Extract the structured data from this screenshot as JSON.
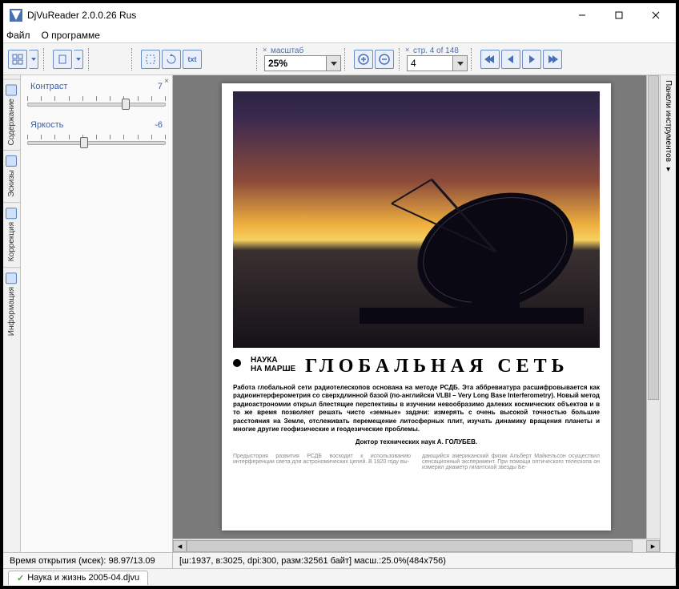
{
  "window": {
    "title": "DjVuReader 2.0.0.26 Rus"
  },
  "menu": {
    "file": "Файл",
    "about": "О программе"
  },
  "toolbar": {
    "scale_label": "масштаб",
    "scale_value": "25%",
    "page_label": "стр. 4 of 148",
    "page_value": "4"
  },
  "side_tabs": {
    "contents": "Содержание",
    "thumbnails": "Эскизы",
    "correction": "Коррекция",
    "information": "Информация"
  },
  "correction": {
    "contrast_label": "Контраст",
    "contrast_value": "7",
    "brightness_label": "Яркость",
    "brightness_value": "-6"
  },
  "right_panel": {
    "label": "Панели инструментов"
  },
  "document": {
    "subhead_line1": "НАУКА",
    "subhead_line2": "НА МАРШЕ",
    "headline": "ГЛОБАЛЬНАЯ СЕТЬ",
    "intro": "Работа глобальной сети радиотелескопов основана на методе РСДБ. Эта аббревиатура расшифровывается как радиоинтерферометрия со сверхдлинной базой (по-английски VLBI – Very Long Base Interferometry). Новый метод радиоастрономии открыл блестящие перспективы в изучении невообразимо далеких космических объектов и в то же время позволяет решать чисто «земные» задачи: измерять с очень высокой точностью большие расстояния на Земле, отслеживать перемещение литосферных плит, изучать динамику вращения планеты и многие другие геофизические и геодезические проблемы.",
    "author": "Доктор технических наук А. ГОЛУБЕВ.",
    "col1": "Предыстория развития РСДБ восходит к использованию интерференции света для астрономических целей. В 1920 году вы-",
    "col2": "дающийся американский физик Альберт Майкельсон осуществил сенсационный эксперимент. При помощи оптического телескопа он измерил диаметр гигантской звезды Бе-"
  },
  "status": {
    "open_time": "Время открытия (мсек): 98.97/13.09",
    "info": "[ш:1937, в:3025, dpi:300, разм:32561 байт] масш.:25.0%(484x756)"
  },
  "tab": {
    "filename": "Наука и жизнь 2005-04.djvu"
  }
}
